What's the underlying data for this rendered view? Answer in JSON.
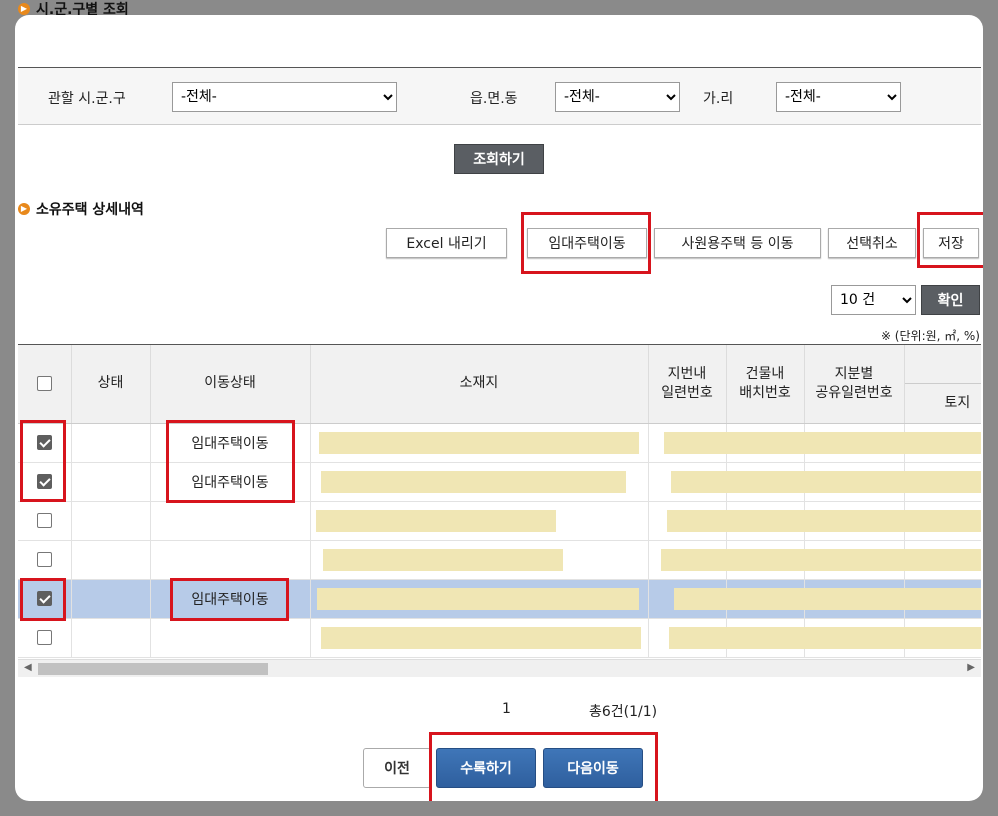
{
  "page_title": "시.군.구별 조회",
  "search": {
    "label_sigungu": "관할 시.군.구",
    "sigungu_value": "-전체-",
    "label_eupmyeondong": "읍.면.동",
    "eupmyeondong_value": "-전체-",
    "label_gari": "가.리",
    "gari_value": "-전체-",
    "button": "조회하기"
  },
  "section_title": "소유주택 상세내역",
  "toolbar": {
    "excel": "Excel 내리기",
    "rental_move": "임대주택이동",
    "company_move": "사원용주택 등 이동",
    "deselect": "선택취소",
    "save": "저장"
  },
  "page_size": {
    "value": "10 건",
    "confirm": "확인"
  },
  "unit_note": "※ (단위:원, ㎡, %)",
  "table": {
    "headers": {
      "status": "상태",
      "move_status": "이동상태",
      "location": "소재지",
      "lot_serial_1": "지번내",
      "lot_serial_2": "일련번호",
      "building_serial_1": "건물내",
      "building_serial_2": "배치번호",
      "share_serial_1": "지분별",
      "share_serial_2": "공유일련번호",
      "land": "토지"
    },
    "rows": [
      {
        "checked": true,
        "status": "",
        "move_status": "임대주택이동",
        "selected": false
      },
      {
        "checked": true,
        "status": "",
        "move_status": "임대주택이동",
        "selected": false
      },
      {
        "checked": false,
        "status": "",
        "move_status": "",
        "selected": false
      },
      {
        "checked": false,
        "status": "",
        "move_status": "",
        "selected": false
      },
      {
        "checked": true,
        "status": "",
        "move_status": "임대주택이동",
        "selected": true
      },
      {
        "checked": false,
        "status": "",
        "move_status": "",
        "selected": false
      }
    ]
  },
  "pagination": {
    "current": "1",
    "total": "총6건(1/1)"
  },
  "footer": {
    "prev": "이전",
    "submit": "수록하기",
    "next": "다음이동"
  },
  "colors": {
    "highlight_box": "#d7141d",
    "selected_row": "#b7cbe8",
    "primary_button": "#2f5f9e"
  }
}
